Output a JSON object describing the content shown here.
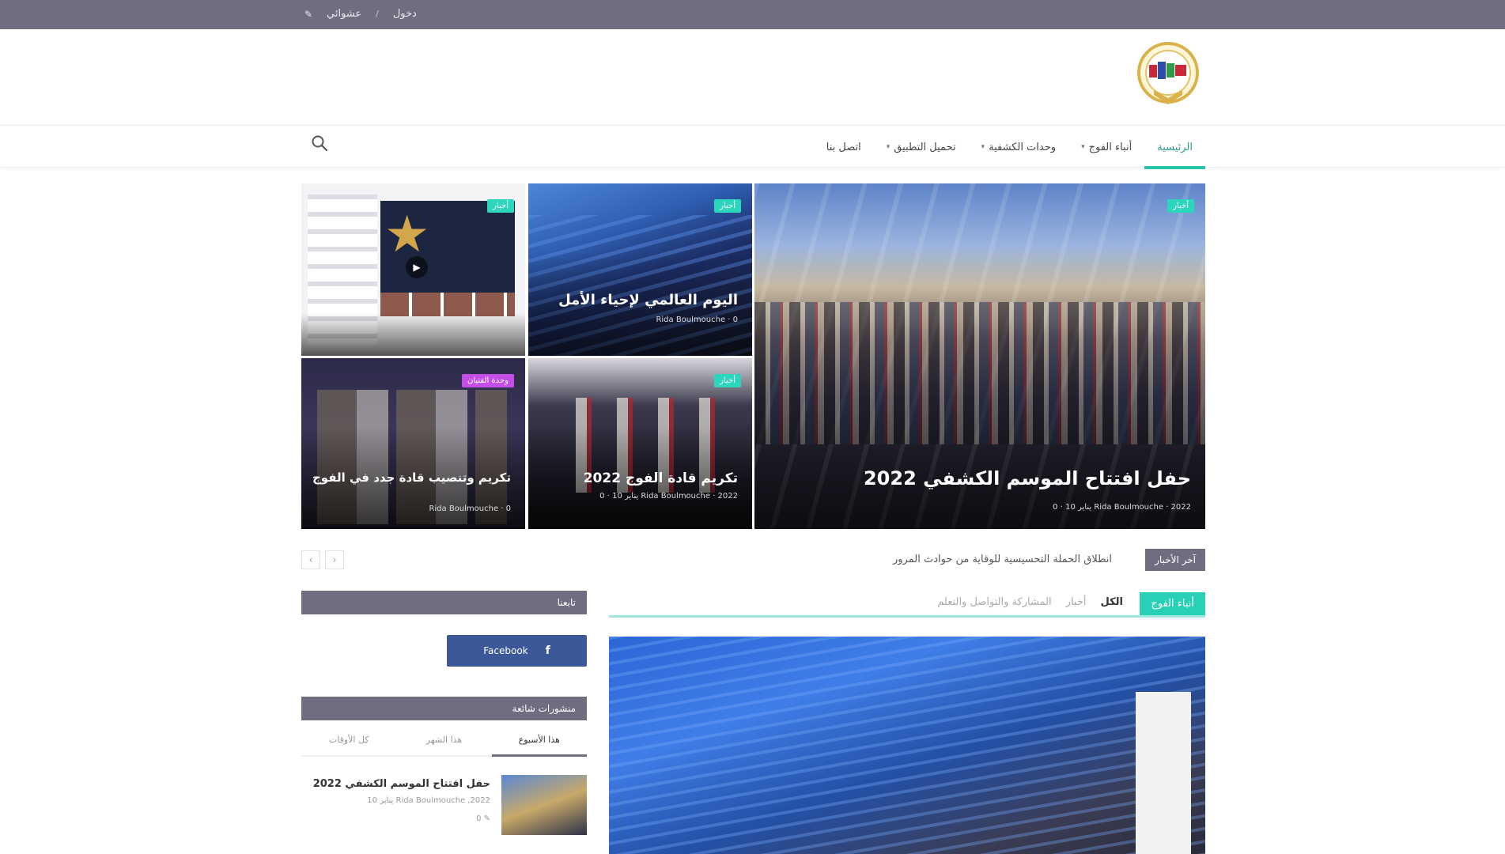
{
  "topbar": {
    "links": [
      "دخول",
      "عشوائي"
    ],
    "random_icon": "shuffle-icon"
  },
  "nav": {
    "items": [
      {
        "label": "الرئيسية",
        "active": true,
        "dropdown": false
      },
      {
        "label": "أنباء الفوج",
        "active": false,
        "dropdown": true
      },
      {
        "label": "وحدات الكشفية",
        "active": false,
        "dropdown": true
      },
      {
        "label": "تحميل التطبيق",
        "active": false,
        "dropdown": true
      },
      {
        "label": "اتصل بنا",
        "active": false,
        "dropdown": false
      }
    ],
    "search_icon": "search-icon",
    "accent": "#28c3a9"
  },
  "featured": {
    "main": {
      "category": "أخبار",
      "title": "حفل افتتاح الموسم الكشفي 2022",
      "meta": "Rida Boulmouche · 2022 يناير 10 · 0"
    },
    "tile_a": {
      "category": "أخبار",
      "title": "اليوم العالمي لإحياء الأمل",
      "meta": "Rida Boulmouche · 0"
    },
    "tile_b": {
      "category": "أخبار",
      "play_icon": "play-icon"
    },
    "tile_c": {
      "category": "أخبار",
      "title": "تكريم قادة الفوج 2022",
      "meta": "Rida Boulmouche · 2022 يناير 10 · 0"
    },
    "tile_d": {
      "category": "وحدة الفتيان",
      "title": "تكريم وتنصيب قادة جدد في الفوج",
      "meta": "Rida Boulmouche · 0"
    }
  },
  "ticker": {
    "label": "آخر الأخبار",
    "text": "انطلاق الحملة التحسيسية للوقاية من حوادث المرور",
    "prev": "‹",
    "next": "›"
  },
  "block": {
    "title": "أنباء الفوج",
    "tabs": [
      "الكل",
      "أخبار",
      "المشاركة والتواصل والتعلم"
    ]
  },
  "sidebar": {
    "follow_title": "تابعنا",
    "facebook_label": "Facebook",
    "facebook_icon": "facebook-icon",
    "popular_title": "منشورات شائعة",
    "tabs": [
      "هذا الأسبوع",
      "هذا الشهر",
      "كل الأوقات"
    ],
    "post": {
      "title": "حفل افتتاح الموسم الكشفي 2022",
      "meta": "Rida Boulmouche ,2022 يناير 10",
      "comments": "0 ✎"
    }
  }
}
